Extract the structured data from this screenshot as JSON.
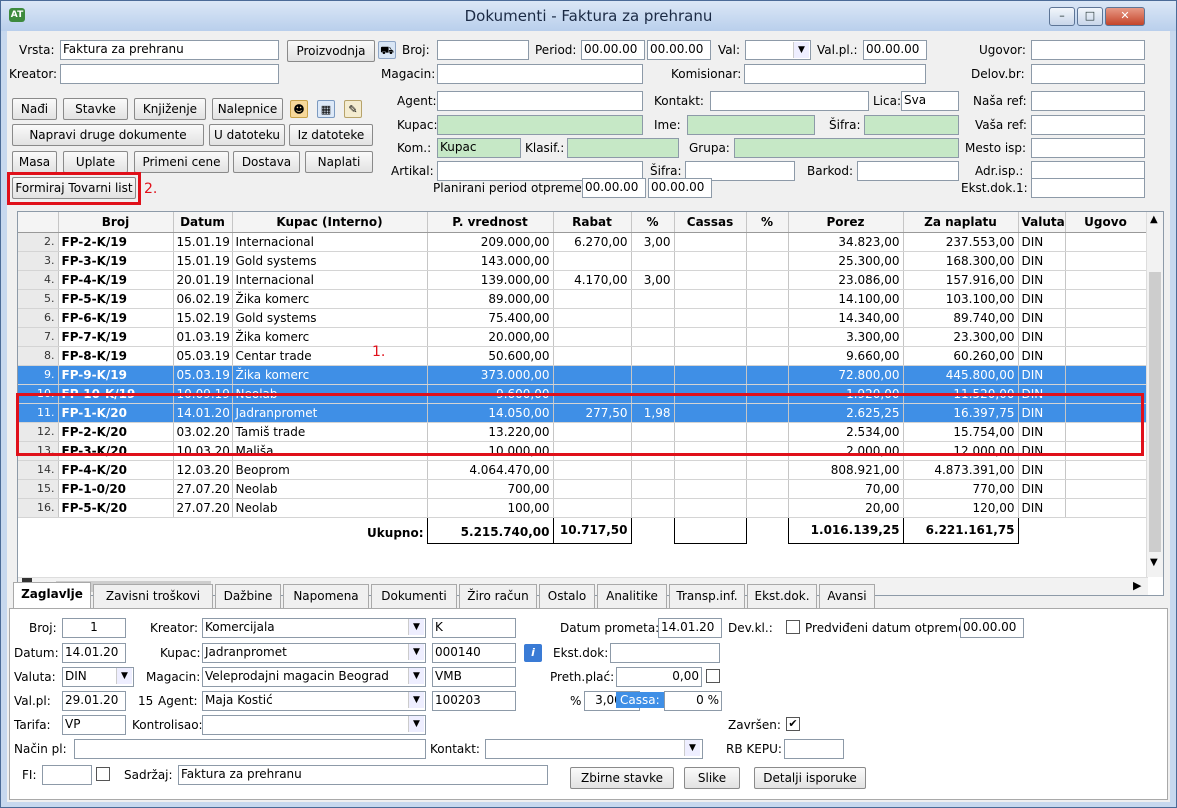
{
  "window": {
    "title": "Dokumenti - Faktura za prehranu",
    "logo": "AT"
  },
  "header": {
    "vrsta_label": "Vrsta:",
    "vrsta_value": "Faktura za prehranu",
    "proizvodnja": "Proizvodnja",
    "kreator_label": "Kreator:",
    "kreator_value": "",
    "broj_label": "Broj:",
    "period_label": "Period:",
    "period_from": "00.00.00",
    "period_to": "00.00.00",
    "val_label": "Val:",
    "valpl_label": "Val.pl.:",
    "valpl_value": "00.00.00",
    "ugovor_label": "Ugovor:",
    "magacin_label": "Magacin:",
    "komisionar_label": "Komisionar:",
    "delovbr_label": "Delov.br:",
    "agent_label": "Agent:",
    "kontakt_label": "Kontakt:",
    "lica_label": "Lica:",
    "lica_value": "Sva",
    "nasaref_label": "Naša ref:",
    "kupac_label": "Kupac:",
    "ime_label": "Ime:",
    "sifra_label": "Šifra:",
    "vasaref_label": "Vaša ref:",
    "kom_label": "Kom.:",
    "kom_value": "Kupac",
    "klasif_label": "Klasif.:",
    "grupa_label": "Grupa:",
    "mestoisp_label": "Mesto isp:",
    "artikal_label": "Artikal:",
    "sifra2_label": "Šifra:",
    "barkod_label": "Barkod:",
    "adrisp_label": "Adr.isp.:",
    "plan_label": "Planirani period otpreme:",
    "plan_from": "00.00.00",
    "plan_to": "00.00.00",
    "ekstdok1_label": "Ekst.dok.1:"
  },
  "buttons": {
    "nadji": "Nađi",
    "stavke": "Stavke",
    "knjizenje": "Knjiženje",
    "nalepnice": "Nalepnice",
    "napravi": "Napravi druge dokumente",
    "udatoteku": "U datoteku",
    "izdatoteke": "Iz datoteke",
    "masa": "Masa",
    "uplate": "Uplate",
    "primeni": "Primeni cene",
    "dostava": "Dostava",
    "naplati": "Naplati",
    "tovarni": "Formiraj Tovarni list"
  },
  "annotations": {
    "one": "1.",
    "two": "2."
  },
  "grid": {
    "columns": [
      "Broj",
      "Datum",
      "Kupac (Interno)",
      "P. vrednost",
      "Rabat",
      "%",
      "Cassas",
      "%",
      "Porez",
      "Za naplatu",
      "Valuta",
      "Ugovo"
    ],
    "rows": [
      {
        "n": "2.",
        "broj": "FP-2-K/19",
        "datum": "15.01.19",
        "kupac": "Internacional",
        "pv": "209.000,00",
        "rabat": "6.270,00",
        "pct": "3,00",
        "cassas": "",
        "pct2": "",
        "porez": "34.823,00",
        "zanapl": "237.553,00",
        "val": "DIN",
        "sel": false
      },
      {
        "n": "3.",
        "broj": "FP-3-K/19",
        "datum": "15.01.19",
        "kupac": "Gold systems",
        "pv": "143.000,00",
        "rabat": "",
        "pct": "",
        "cassas": "",
        "pct2": "",
        "porez": "25.300,00",
        "zanapl": "168.300,00",
        "val": "DIN",
        "sel": false
      },
      {
        "n": "4.",
        "broj": "FP-4-K/19",
        "datum": "20.01.19",
        "kupac": "Internacional",
        "pv": "139.000,00",
        "rabat": "4.170,00",
        "pct": "3,00",
        "cassas": "",
        "pct2": "",
        "porez": "23.086,00",
        "zanapl": "157.916,00",
        "val": "DIN",
        "sel": false
      },
      {
        "n": "5.",
        "broj": "FP-5-K/19",
        "datum": "06.02.19",
        "kupac": "Žika komerc",
        "pv": "89.000,00",
        "rabat": "",
        "pct": "",
        "cassas": "",
        "pct2": "",
        "porez": "14.100,00",
        "zanapl": "103.100,00",
        "val": "DIN",
        "sel": false
      },
      {
        "n": "6.",
        "broj": "FP-6-K/19",
        "datum": "15.02.19",
        "kupac": "Gold systems",
        "pv": "75.400,00",
        "rabat": "",
        "pct": "",
        "cassas": "",
        "pct2": "",
        "porez": "14.340,00",
        "zanapl": "89.740,00",
        "val": "DIN",
        "sel": false
      },
      {
        "n": "7.",
        "broj": "FP-7-K/19",
        "datum": "01.03.19",
        "kupac": "Žika komerc",
        "pv": "20.000,00",
        "rabat": "",
        "pct": "",
        "cassas": "",
        "pct2": "",
        "porez": "3.300,00",
        "zanapl": "23.300,00",
        "val": "DIN",
        "sel": false
      },
      {
        "n": "8.",
        "broj": "FP-8-K/19",
        "datum": "05.03.19",
        "kupac": "Centar trade",
        "pv": "50.600,00",
        "rabat": "",
        "pct": "",
        "cassas": "",
        "pct2": "",
        "porez": "9.660,00",
        "zanapl": "60.260,00",
        "val": "DIN",
        "sel": false
      },
      {
        "n": "9.",
        "broj": "FP-9-K/19",
        "datum": "05.03.19",
        "kupac": "Žika komerc",
        "pv": "373.000,00",
        "rabat": "",
        "pct": "",
        "cassas": "",
        "pct2": "",
        "porez": "72.800,00",
        "zanapl": "445.800,00",
        "val": "DIN",
        "sel": true
      },
      {
        "n": "10.",
        "broj": "FP-10-K/19",
        "datum": "10.09.19",
        "kupac": "Neolab",
        "pv": "9.600,00",
        "rabat": "",
        "pct": "",
        "cassas": "",
        "pct2": "",
        "porez": "1.920,00",
        "zanapl": "11.520,00",
        "val": "DIN",
        "sel": true
      },
      {
        "n": "11.",
        "broj": "FP-1-K/20",
        "datum": "14.01.20",
        "kupac": "Jadranpromet",
        "pv": "14.050,00",
        "rabat": "277,50",
        "pct": "1,98",
        "cassas": "",
        "pct2": "",
        "porez": "2.625,25",
        "zanapl": "16.397,75",
        "val": "DIN",
        "sel": true
      },
      {
        "n": "12.",
        "broj": "FP-2-K/20",
        "datum": "03.02.20",
        "kupac": "Tamiš trade",
        "pv": "13.220,00",
        "rabat": "",
        "pct": "",
        "cassas": "",
        "pct2": "",
        "porez": "2.534,00",
        "zanapl": "15.754,00",
        "val": "DIN",
        "sel": false
      },
      {
        "n": "13.",
        "broj": "FP-3-K/20",
        "datum": "10.03.20",
        "kupac": "Mališa",
        "pv": "10.000,00",
        "rabat": "",
        "pct": "",
        "cassas": "",
        "pct2": "",
        "porez": "2.000,00",
        "zanapl": "12.000,00",
        "val": "DIN",
        "sel": false
      },
      {
        "n": "14.",
        "broj": "FP-4-K/20",
        "datum": "12.03.20",
        "kupac": "Beoprom",
        "pv": "4.064.470,00",
        "rabat": "",
        "pct": "",
        "cassas": "",
        "pct2": "",
        "porez": "808.921,00",
        "zanapl": "4.873.391,00",
        "val": "DIN",
        "sel": false
      },
      {
        "n": "15.",
        "broj": "FP-1-0/20",
        "datum": "27.07.20",
        "kupac": "Neolab",
        "pv": "700,00",
        "rabat": "",
        "pct": "",
        "cassas": "",
        "pct2": "",
        "porez": "70,00",
        "zanapl": "770,00",
        "val": "DIN",
        "sel": false
      },
      {
        "n": "16.",
        "broj": "FP-5-K/20",
        "datum": "27.07.20",
        "kupac": "Neolab",
        "pv": "100,00",
        "rabat": "",
        "pct": "",
        "cassas": "",
        "pct2": "",
        "porez": "20,00",
        "zanapl": "120,00",
        "val": "DIN",
        "sel": false
      }
    ],
    "totals": {
      "label": "Ukupno:",
      "pv": "5.215.740,00",
      "rabat": "10.717,50",
      "porez": "1.016.139,25",
      "zanapl": "6.221.161,75"
    }
  },
  "tabs": [
    "Zaglavlje",
    "Zavisni troškovi",
    "Dažbine",
    "Napomena",
    "Dokumenti",
    "Žiro račun",
    "Ostalo",
    "Analitike",
    "Transp.inf.",
    "Ekst.dok.",
    "Avansi"
  ],
  "detail": {
    "broj_label": "Broj:",
    "broj": "1",
    "kreator_label": "Kreator:",
    "kreator": "Komercijala",
    "k": "K",
    "datprom_label": "Datum prometa:",
    "datprom": "14.01.20",
    "devkl_label": "Dev.kl.:",
    "predv_label": "Predviđeni datum otpreme",
    "predv": "00.00.00",
    "datum_label": "Datum:",
    "datum": "14.01.20",
    "kupac_label": "Kupac:",
    "kupac": "Jadranpromet",
    "kupac_code": "000140",
    "ekstdok_label": "Ekst.dok:",
    "valuta_label": "Valuta:",
    "valuta": "DIN",
    "magacin_label": "Magacin:",
    "magacin": "Veleprodajni magacin Beograd",
    "mag_code": "VMB",
    "prethplac_label": "Preth.plać:",
    "prethplac": "0,00",
    "valpl_label": "Val.pl:",
    "valpl": "29.01.20",
    "days": "15",
    "agent_label": "Agent:",
    "agent": "Maja Kostić",
    "agent_code": "100203",
    "pct_label": "%",
    "pct": "3,00 %",
    "cassa_label": "Cassa:",
    "cassa": "0 %",
    "tarifa_label": "Tarifa:",
    "tarifa": "VP",
    "kontrolisao_label": "Kontrolisao:",
    "zavrsen_label": "Završen:",
    "nacinpl_label": "Način pl:",
    "kontakt_label": "Kontakt:",
    "rbkepu_label": "RB KEPU:",
    "fi_label": "FI:",
    "sadrzaj_label": "Sadržaj:",
    "sadrzaj": "Faktura za prehranu",
    "zbirne": "Zbirne stavke",
    "slike": "Slike",
    "detalji": "Detalji isporuke"
  },
  "colors": {
    "selection": "#3f8fe6",
    "highlight": "#e0101a",
    "green_field": "#c6e8c6"
  }
}
